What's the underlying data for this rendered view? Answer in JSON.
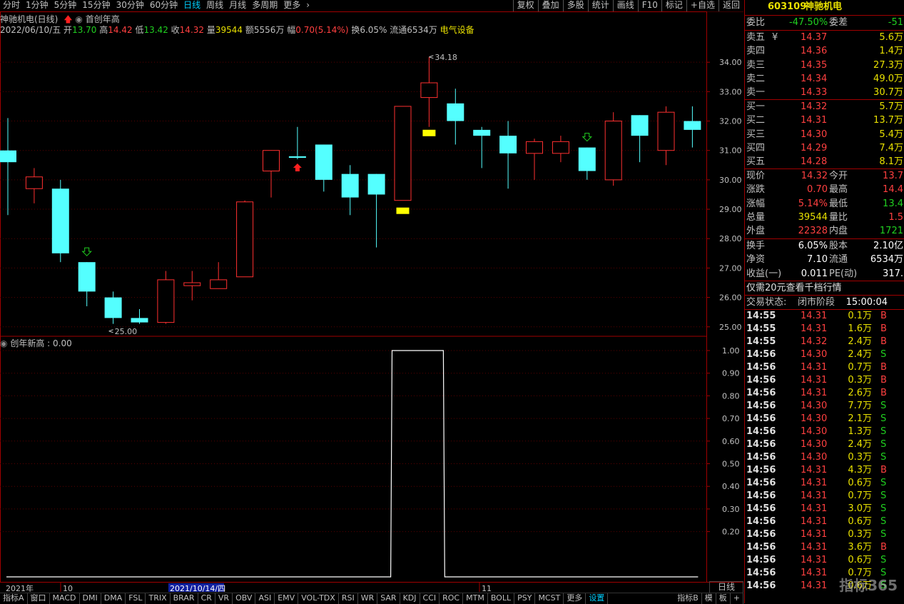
{
  "toolbar": {
    "periods": [
      "分时",
      "1分钟",
      "5分钟",
      "15分钟",
      "30分钟",
      "60分钟",
      "日线",
      "周线",
      "月线",
      "多周期",
      "更多"
    ],
    "active_period": "日线",
    "tools": [
      "复权",
      "叠加",
      "多股",
      "统计",
      "画线",
      "F10",
      "标记",
      "+自选",
      "返回"
    ]
  },
  "header": {
    "title": "神驰机电(日线)",
    "indicator": "首创年高",
    "date": "2022/06/10/五",
    "open_label": "开",
    "open": "13.70",
    "high_label": "高",
    "high": "14.42",
    "low_label": "低",
    "low": "13.42",
    "close_label": "收",
    "close": "14.32",
    "vol_label": "量",
    "vol": "39544",
    "amount_label": "额",
    "amount": "5556万",
    "range_label": "幅",
    "range": "0.70(5.14%)",
    "turnover": "换6.05%",
    "float": "流通6534万",
    "sector": "电气设备"
  },
  "sub_header": {
    "label": "创年新高",
    "value": "0.00"
  },
  "chart_data": [
    {
      "type": "candlestick",
      "title": "神驰机电(日线)",
      "y_ticks": [
        "34.00",
        "33.00",
        "32.00",
        "31.00",
        "30.00",
        "29.00",
        "28.00",
        "27.00",
        "26.00",
        "25.00"
      ],
      "ylim": [
        24.8,
        35.0
      ],
      "annotations": {
        "high": "34.18",
        "low": "25.00"
      },
      "candles": [
        {
          "o": 31.0,
          "h": 32.1,
          "l": 28.8,
          "c": 30.6
        },
        {
          "o": 29.7,
          "h": 30.4,
          "l": 29.2,
          "c": 30.1
        },
        {
          "o": 29.7,
          "h": 30.0,
          "l": 27.2,
          "c": 27.5
        },
        {
          "o": 27.2,
          "h": 27.2,
          "l": 25.7,
          "c": 26.2
        },
        {
          "o": 26.0,
          "h": 26.2,
          "l": 25.1,
          "c": 25.3
        },
        {
          "o": 25.3,
          "h": 25.6,
          "l": 25.1,
          "c": 25.15
        },
        {
          "o": 25.15,
          "h": 26.9,
          "l": 25.1,
          "c": 26.6
        },
        {
          "o": 26.4,
          "h": 26.9,
          "l": 25.9,
          "c": 26.5
        },
        {
          "o": 26.3,
          "h": 27.2,
          "l": 26.3,
          "c": 26.6
        },
        {
          "o": 26.7,
          "h": 29.3,
          "l": 26.7,
          "c": 29.25
        },
        {
          "o": 30.3,
          "h": 31.0,
          "l": 29.4,
          "c": 31.0
        },
        {
          "o": 30.8,
          "h": 31.8,
          "l": 30.7,
          "c": 30.75
        },
        {
          "o": 31.2,
          "h": 31.2,
          "l": 29.6,
          "c": 30.0
        },
        {
          "o": 30.2,
          "h": 30.5,
          "l": 28.8,
          "c": 29.4
        },
        {
          "o": 30.2,
          "h": 30.2,
          "l": 27.7,
          "c": 29.5
        },
        {
          "o": 29.3,
          "h": 32.5,
          "l": 29.3,
          "c": 32.5
        },
        {
          "o": 32.8,
          "h": 34.18,
          "l": 31.8,
          "c": 33.3
        },
        {
          "o": 32.6,
          "h": 33.1,
          "l": 31.2,
          "c": 32.0
        },
        {
          "o": 31.7,
          "h": 31.8,
          "l": 30.4,
          "c": 31.5
        },
        {
          "o": 31.5,
          "h": 32.0,
          "l": 29.7,
          "c": 30.9
        },
        {
          "o": 30.9,
          "h": 31.4,
          "l": 30.0,
          "c": 31.3
        },
        {
          "o": 30.9,
          "h": 31.5,
          "l": 30.6,
          "c": 31.3
        },
        {
          "o": 31.1,
          "h": 31.1,
          "l": 30.0,
          "c": 30.3
        },
        {
          "o": 30.0,
          "h": 32.3,
          "l": 29.8,
          "c": 32.0
        },
        {
          "o": 32.2,
          "h": 32.2,
          "l": 30.6,
          "c": 31.5
        },
        {
          "o": 31.0,
          "h": 32.5,
          "l": 30.5,
          "c": 32.3
        },
        {
          "o": 32.0,
          "h": 32.5,
          "l": 31.1,
          "c": 31.7
        }
      ],
      "markers": [
        {
          "index": 3,
          "type": "green-hollow-arrow-down"
        },
        {
          "index": 11,
          "type": "red-arrow-up"
        },
        {
          "index": 15,
          "type": "yellow-block"
        },
        {
          "index": 16,
          "type": "yellow-block"
        },
        {
          "index": 22,
          "type": "green-hollow-arrow-down"
        }
      ],
      "x_labels": [
        "2021年",
        "10",
        "2021/10/14/四",
        "11"
      ]
    },
    {
      "type": "line",
      "title": "创年新高",
      "y_ticks": [
        "1.00",
        "0.90",
        "0.80",
        "0.70",
        "0.60",
        "0.50",
        "0.40",
        "0.30",
        "0.20"
      ],
      "ylim": [
        0,
        1.0
      ],
      "values": [
        0,
        0,
        0,
        0,
        0,
        0,
        0,
        0,
        0,
        0,
        0,
        0,
        0,
        0,
        0,
        1,
        1,
        0,
        0,
        0,
        0,
        0,
        0,
        0,
        0,
        0,
        0
      ]
    }
  ],
  "side": {
    "code": "603109",
    "name": "神驰机电",
    "weibi_label": "委比",
    "weibi": "-47.50%",
    "weicha_label": "委差",
    "weicha": "-51",
    "asks": [
      {
        "label": "卖五",
        "tag": "¥",
        "price": "14.37",
        "vol": "5.6万"
      },
      {
        "label": "卖四",
        "tag": "",
        "price": "14.36",
        "vol": "1.4万"
      },
      {
        "label": "卖三",
        "tag": "",
        "price": "14.35",
        "vol": "27.3万"
      },
      {
        "label": "卖二",
        "tag": "",
        "price": "14.34",
        "vol": "49.0万"
      },
      {
        "label": "卖一",
        "tag": "",
        "price": "14.33",
        "vol": "30.7万"
      }
    ],
    "bids": [
      {
        "label": "买一",
        "price": "14.32",
        "vol": "5.7万"
      },
      {
        "label": "买二",
        "price": "14.31",
        "vol": "13.7万"
      },
      {
        "label": "买三",
        "price": "14.30",
        "vol": "5.4万"
      },
      {
        "label": "买四",
        "price": "14.29",
        "vol": "7.4万"
      },
      {
        "label": "买五",
        "price": "14.28",
        "vol": "8.1万"
      }
    ],
    "stats": [
      {
        "l1": "现价",
        "v1": "14.32",
        "c1": "red",
        "l2": "今开",
        "v2": "13.7",
        "c2": "red"
      },
      {
        "l1": "涨跌",
        "v1": "0.70",
        "c1": "red",
        "l2": "最高",
        "v2": "14.4",
        "c2": "red"
      },
      {
        "l1": "涨幅",
        "v1": "5.14%",
        "c1": "red",
        "l2": "最低",
        "v2": "13.4",
        "c2": "grn"
      },
      {
        "l1": "总量",
        "v1": "39544",
        "c1": "yel",
        "l2": "量比",
        "v2": "1.5",
        "c2": "red"
      },
      {
        "l1": "外盘",
        "v1": "22328",
        "c1": "red",
        "l2": "内盘",
        "v2": "1721",
        "c2": "grn"
      }
    ],
    "stats2": [
      {
        "l1": "换手",
        "v1": "6.05%",
        "l2": "股本",
        "v2": "2.10亿"
      },
      {
        "l1": "净资",
        "v1": "7.10",
        "l2": "流通",
        "v2": "6534万"
      },
      {
        "l1": "收益(一)",
        "v1": "0.011",
        "l2": "PE(动)",
        "v2": "317."
      }
    ],
    "promo": "仅需20元查看千档行情",
    "status_label": "交易状态:",
    "status": "闭市阶段",
    "status_time": "15:00:04",
    "ticks": [
      {
        "t": "14:55",
        "p": "14.31",
        "v": "0.1万",
        "d": "B"
      },
      {
        "t": "14:55",
        "p": "14.31",
        "v": "1.6万",
        "d": "B"
      },
      {
        "t": "14:55",
        "p": "14.32",
        "v": "2.4万",
        "d": "B"
      },
      {
        "t": "14:56",
        "p": "14.30",
        "v": "2.4万",
        "d": "S"
      },
      {
        "t": "14:56",
        "p": "14.31",
        "v": "0.7万",
        "d": "B"
      },
      {
        "t": "14:56",
        "p": "14.31",
        "v": "0.3万",
        "d": "B"
      },
      {
        "t": "14:56",
        "p": "14.31",
        "v": "2.6万",
        "d": "B"
      },
      {
        "t": "14:56",
        "p": "14.30",
        "v": "7.7万",
        "d": "S"
      },
      {
        "t": "14:56",
        "p": "14.30",
        "v": "2.1万",
        "d": "S"
      },
      {
        "t": "14:56",
        "p": "14.30",
        "v": "1.3万",
        "d": "S"
      },
      {
        "t": "14:56",
        "p": "14.30",
        "v": "2.4万",
        "d": "S"
      },
      {
        "t": "14:56",
        "p": "14.30",
        "v": "0.3万",
        "d": "S"
      },
      {
        "t": "14:56",
        "p": "14.31",
        "v": "4.3万",
        "d": "B"
      },
      {
        "t": "14:56",
        "p": "14.31",
        "v": "0.6万",
        "d": "S"
      },
      {
        "t": "14:56",
        "p": "14.31",
        "v": "0.7万",
        "d": "S"
      },
      {
        "t": "14:56",
        "p": "14.31",
        "v": "3.0万",
        "d": "S"
      },
      {
        "t": "14:56",
        "p": "14.31",
        "v": "0.6万",
        "d": "S"
      },
      {
        "t": "14:56",
        "p": "14.31",
        "v": "0.3万",
        "d": "S"
      },
      {
        "t": "14:56",
        "p": "14.31",
        "v": "3.6万",
        "d": "B"
      },
      {
        "t": "14:56",
        "p": "14.31",
        "v": "0.6万",
        "d": "S"
      },
      {
        "t": "14:56",
        "p": "14.31",
        "v": "0.7万",
        "d": "S"
      },
      {
        "t": "14:56",
        "p": "14.31",
        "v": "0.6万",
        "d": "S"
      }
    ],
    "watermark": "指标365"
  },
  "right_axis_tab": "日线",
  "bottom_tabs": [
    "指标A",
    "窗口",
    "MACD",
    "DMI",
    "DMA",
    "FSL",
    "TRIX",
    "BRAR",
    "CR",
    "VR",
    "OBV",
    "ASI",
    "EMV",
    "VOL-TDX",
    "RSI",
    "WR",
    "SAR",
    "KDJ",
    "CCI",
    "ROC",
    "MTM",
    "BOLL",
    "PSY",
    "MCST",
    "更多",
    "设置"
  ],
  "bottom_right_tabs": [
    "指标B",
    "模",
    "板",
    "+"
  ],
  "colors": {
    "up": "#ff3030",
    "down": "#54ffff",
    "marker_yellow": "#ffff00",
    "panel_border": "#a00000"
  }
}
